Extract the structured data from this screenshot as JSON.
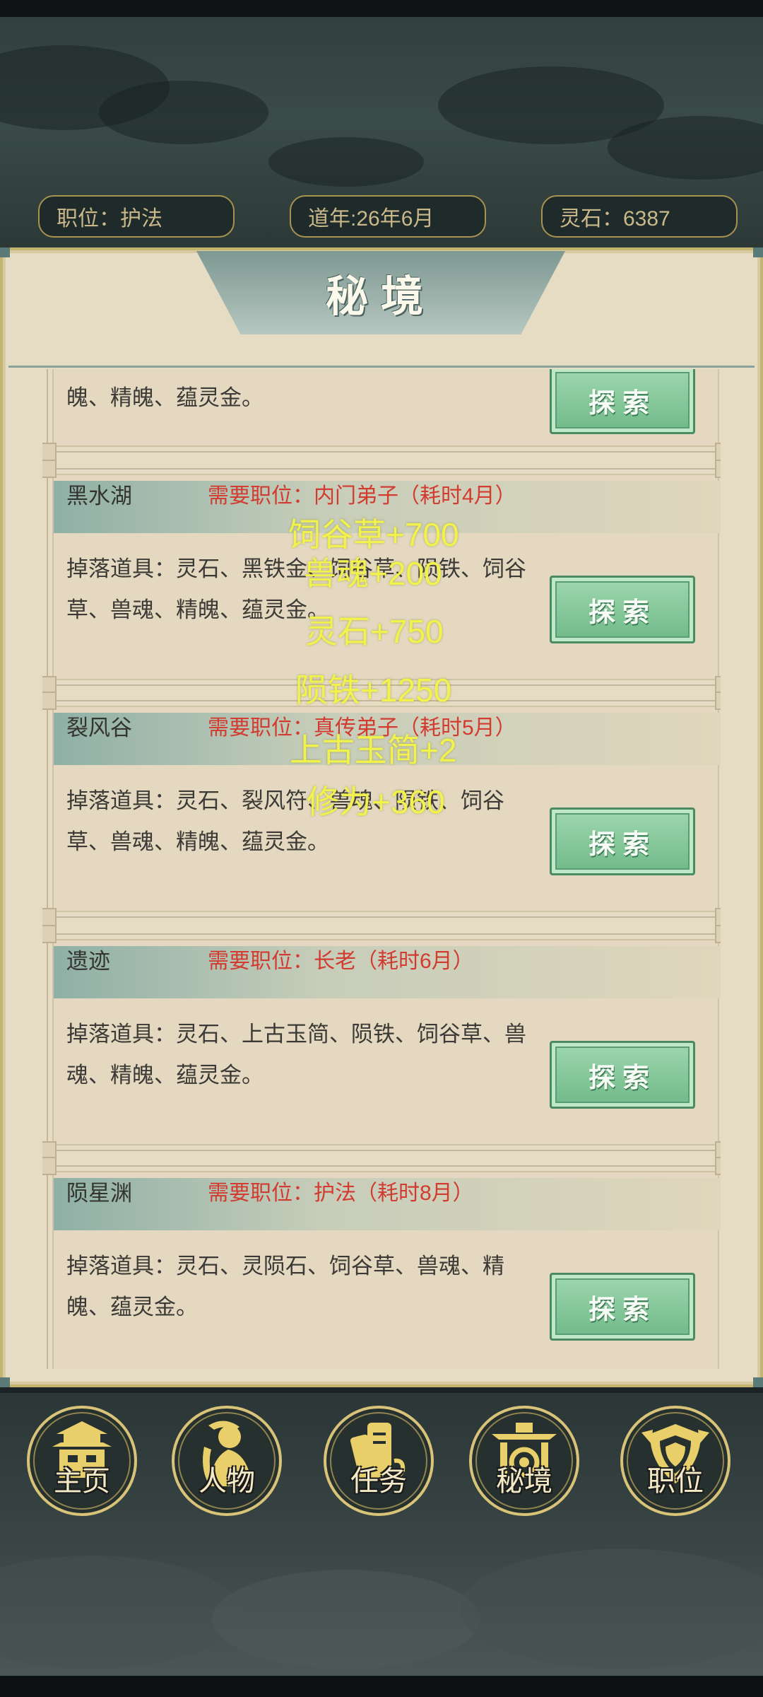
{
  "status": {
    "position": "职位：护法",
    "year": "道年:26年6月",
    "spirit_stones": "灵石：6387"
  },
  "title": "秘境",
  "partial_card": {
    "drops_tail": "魄、精魄、蕴灵金。",
    "button": "探索"
  },
  "cards": [
    {
      "name": "黑水湖",
      "requirement": "需要职位：内门弟子（耗时4月）",
      "drops": "掉落道具：灵石、黑铁金、饲谷草、陨铁、饲谷草、兽魂、精魄、蕴灵金。",
      "button": "探索"
    },
    {
      "name": "裂风谷",
      "requirement": "需要职位：真传弟子（耗时5月）",
      "drops": "掉落道具：灵石、裂风符、兽魂、陨铁、饲谷草、兽魂、精魄、蕴灵金。",
      "button": "探索"
    },
    {
      "name": "遗迹",
      "requirement": "需要职位：长老（耗时6月）",
      "drops": "掉落道具：灵石、上古玉简、陨铁、饲谷草、兽魂、精魄、蕴灵金。",
      "button": "探索"
    },
    {
      "name": "陨星渊",
      "requirement": "需要职位：护法（耗时8月）",
      "drops": "掉落道具：灵石、灵陨石、饲谷草、兽魂、精魄、蕴灵金。",
      "button": "探索"
    }
  ],
  "rewards": [
    "饲谷草+700",
    "兽魂+200",
    "灵石+750",
    "陨铁+1250",
    "上古玉简+2",
    "修为+360"
  ],
  "nav": [
    {
      "label": "主页",
      "icon": "pagoda-icon"
    },
    {
      "label": "人物",
      "icon": "character-icon"
    },
    {
      "label": "任务",
      "icon": "scroll-icon"
    },
    {
      "label": "秘境",
      "icon": "gate-icon"
    },
    {
      "label": "职位",
      "icon": "shield-icon"
    }
  ],
  "colors": {
    "requirement": "#d23b2f",
    "reward_text": "#f2f24c",
    "button_green": "#6fb988",
    "gold_border": "#d8c378"
  }
}
